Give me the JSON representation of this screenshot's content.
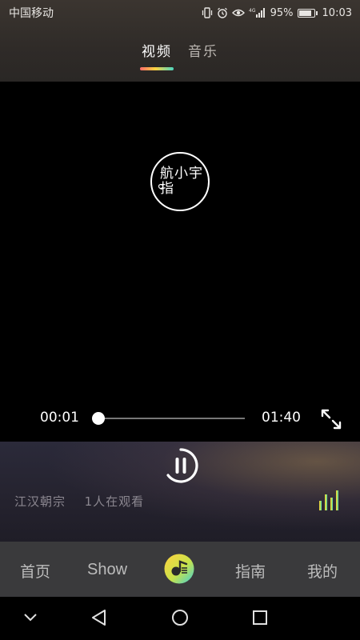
{
  "status_bar": {
    "carrier": "中国移动",
    "network": "4G",
    "battery_percent": "95%",
    "battery_level": 0.95,
    "time": "10:03",
    "icons": [
      "vibrate-icon",
      "alarm-icon",
      "eye-icon",
      "signal-icon",
      "battery-icon"
    ]
  },
  "tabs": [
    {
      "label": "视频",
      "active": true
    },
    {
      "label": "音乐",
      "active": false
    }
  ],
  "video": {
    "logo_text": "航小宇 指",
    "time_current": "00:01",
    "time_total": "01:40",
    "progress": 0.01
  },
  "now_playing": {
    "title": "江汉朝宗",
    "viewers": "1人在观看"
  },
  "bottom_nav": {
    "home": "首页",
    "show": "Show",
    "guide": "指南",
    "mine": "我的"
  },
  "colors": {
    "accent_gradient": [
      "#ff6b6b",
      "#ffd23f",
      "#4ad6c2"
    ],
    "nav_bg": "#3a3a3c"
  }
}
